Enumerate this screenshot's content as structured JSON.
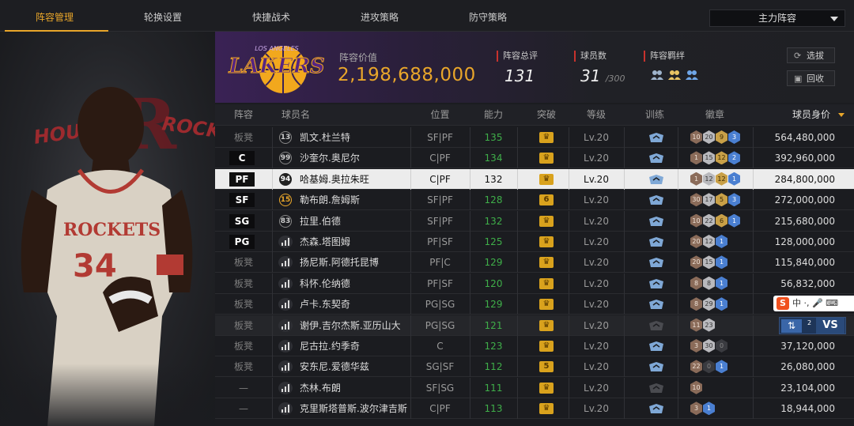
{
  "tabs": [
    {
      "label": "阵容管理",
      "active": true
    },
    {
      "label": "轮换设置",
      "active": false
    },
    {
      "label": "快捷战术",
      "active": false
    },
    {
      "label": "进攻策略",
      "active": false
    },
    {
      "label": "防守策略",
      "active": false
    }
  ],
  "lineup_select": {
    "value": "主力阵容"
  },
  "team": {
    "logo_text": "LAKERS",
    "logo_subtext": "LOS ANGELES"
  },
  "featured_player": {
    "team_text_left": "HOUS",
    "team_text_right": "ROCK",
    "jersey_team": "ROCKETS",
    "jersey_number": "34"
  },
  "lineup_value": {
    "label": "阵容价值",
    "value": "2,198,688,000"
  },
  "stats": {
    "overall": {
      "label": "阵容总评",
      "value": "131"
    },
    "count": {
      "label": "球员数",
      "value": "31",
      "max": "/300"
    },
    "bond": {
      "label": "阵容羁绊"
    }
  },
  "buttons": {
    "scout": "选拔",
    "recall": "回收"
  },
  "columns": {
    "slot": "阵容",
    "name": "球员名",
    "position": "位置",
    "ability": "能力",
    "breakthrough": "突破",
    "level": "等级",
    "training": "训练",
    "badges": "徽章",
    "worth": "球员身价"
  },
  "rows": [
    {
      "slot": "板凳",
      "slot_type": "text",
      "num": "13",
      "name": "凯文.杜兰特",
      "position": "SF|PF",
      "ability": "135",
      "break": "",
      "level": "Lv.20",
      "badges": [
        [
          "10",
          "bronze"
        ],
        [
          "20",
          "silver"
        ],
        [
          "9",
          "gold"
        ],
        [
          "3",
          "blue"
        ]
      ],
      "worth": "564,480,000"
    },
    {
      "slot": "C",
      "slot_type": "badge",
      "num": "99",
      "name": "沙奎尔.奥尼尔",
      "position": "C|PF",
      "ability": "134",
      "break": "",
      "level": "Lv.20",
      "badges": [
        [
          "1",
          "bronze"
        ],
        [
          "15",
          "silver"
        ],
        [
          "12",
          "gold"
        ],
        [
          "2",
          "blue"
        ]
      ],
      "worth": "392,960,000"
    },
    {
      "slot": "PF",
      "slot_type": "badge",
      "num": "94",
      "name": "哈基姆.奥拉朱旺",
      "position": "C|PF",
      "ability": "132",
      "break": "",
      "level": "Lv.20",
      "badges": [
        [
          "1",
          "bronze"
        ],
        [
          "12",
          "silver"
        ],
        [
          "12",
          "gold"
        ],
        [
          "1",
          "blue"
        ]
      ],
      "worth": "284,800,000"
    },
    {
      "slot": "SF",
      "slot_type": "badge",
      "num": "15",
      "name": "勒布朗.詹姆斯",
      "position": "SF|PF",
      "ability": "128",
      "break": "6",
      "level": "Lv.20",
      "badges": [
        [
          "30",
          "bronze"
        ],
        [
          "17",
          "silver"
        ],
        [
          "5",
          "gold"
        ],
        [
          "3",
          "blue"
        ]
      ],
      "worth": "272,000,000"
    },
    {
      "slot": "SG",
      "slot_type": "badge",
      "num": "83",
      "name": "拉里.伯德",
      "position": "SF|PF",
      "ability": "132",
      "break": "",
      "level": "Lv.20",
      "badges": [
        [
          "10",
          "bronze"
        ],
        [
          "22",
          "silver"
        ],
        [
          "6",
          "gold"
        ],
        [
          "1",
          "blue"
        ]
      ],
      "worth": "215,680,000"
    },
    {
      "slot": "PG",
      "slot_type": "badge",
      "num": "",
      "name": "杰森.塔图姆",
      "position": "PF|SF",
      "ability": "125",
      "break": "",
      "level": "Lv.20",
      "badges": [
        [
          "20",
          "bronze"
        ],
        [
          "12",
          "silver"
        ],
        [
          "1",
          "blue"
        ]
      ],
      "worth": "128,000,000"
    },
    {
      "slot": "板凳",
      "slot_type": "text",
      "num": "",
      "name": "扬尼斯.阿德托昆博",
      "position": "PF|C",
      "ability": "129",
      "break": "",
      "level": "Lv.20",
      "badges": [
        [
          "20",
          "bronze"
        ],
        [
          "15",
          "silver"
        ],
        [
          "1",
          "blue"
        ]
      ],
      "worth": "115,840,000"
    },
    {
      "slot": "板凳",
      "slot_type": "text",
      "num": "",
      "name": "科怀.伦纳德",
      "position": "PF|SF",
      "ability": "120",
      "break": "",
      "level": "Lv.20",
      "badges": [
        [
          "8",
          "bronze"
        ],
        [
          "8",
          "silver"
        ],
        [
          "1",
          "blue"
        ]
      ],
      "worth": "56,832,000"
    },
    {
      "slot": "板凳",
      "slot_type": "text",
      "num": "",
      "name": "卢卡.东契奇",
      "position": "PG|SG",
      "ability": "129",
      "break": "",
      "level": "Lv.20",
      "badges": [
        [
          "8",
          "bronze"
        ],
        [
          "29",
          "silver"
        ],
        [
          "1",
          "blue"
        ]
      ],
      "worth": ""
    },
    {
      "slot": "板凳",
      "slot_type": "text",
      "num": "",
      "name": "谢伊.吉尔杰斯.亚历山大",
      "position": "PG|SG",
      "ability": "121",
      "break": "",
      "level": "Lv.20",
      "badges": [
        [
          "11",
          "bronze"
        ],
        [
          "23",
          "silver"
        ]
      ],
      "worth": ""
    },
    {
      "slot": "板凳",
      "slot_type": "text",
      "num": "",
      "name": "尼古拉.约季奇",
      "position": "C",
      "ability": "123",
      "break": "",
      "level": "Lv.20",
      "badges": [
        [
          "3",
          "bronze"
        ],
        [
          "30",
          "silver"
        ],
        [
          "0",
          "dark"
        ]
      ],
      "worth": "37,120,000"
    },
    {
      "slot": "板凳",
      "slot_type": "text",
      "num": "",
      "name": "安东尼.爱德华兹",
      "position": "SG|SF",
      "ability": "112",
      "break": "5",
      "level": "Lv.20",
      "badges": [
        [
          "22",
          "bronze"
        ],
        [
          "0",
          "dark"
        ],
        [
          "1",
          "blue"
        ]
      ],
      "worth": "26,080,000"
    },
    {
      "slot": "—",
      "slot_type": "text",
      "num": "",
      "name": "杰林.布朗",
      "position": "SF|SG",
      "ability": "111",
      "break": "",
      "level": "Lv.20",
      "badges": [
        [
          "10",
          "bronze"
        ]
      ],
      "worth": "23,104,000"
    },
    {
      "slot": "—",
      "slot_type": "text",
      "num": "",
      "name": "克里斯塔普斯.波尔津吉斯",
      "position": "C|PF",
      "ability": "113",
      "break": "",
      "level": "Lv.20",
      "badges": [
        [
          "3",
          "bronze"
        ],
        [
          "1",
          "blue"
        ]
      ],
      "worth": "18,944,000"
    }
  ],
  "overlay": {
    "ime_text": "中 ·, 🎤 ⌨",
    "vs_label": "VS",
    "vs_num": "2"
  }
}
